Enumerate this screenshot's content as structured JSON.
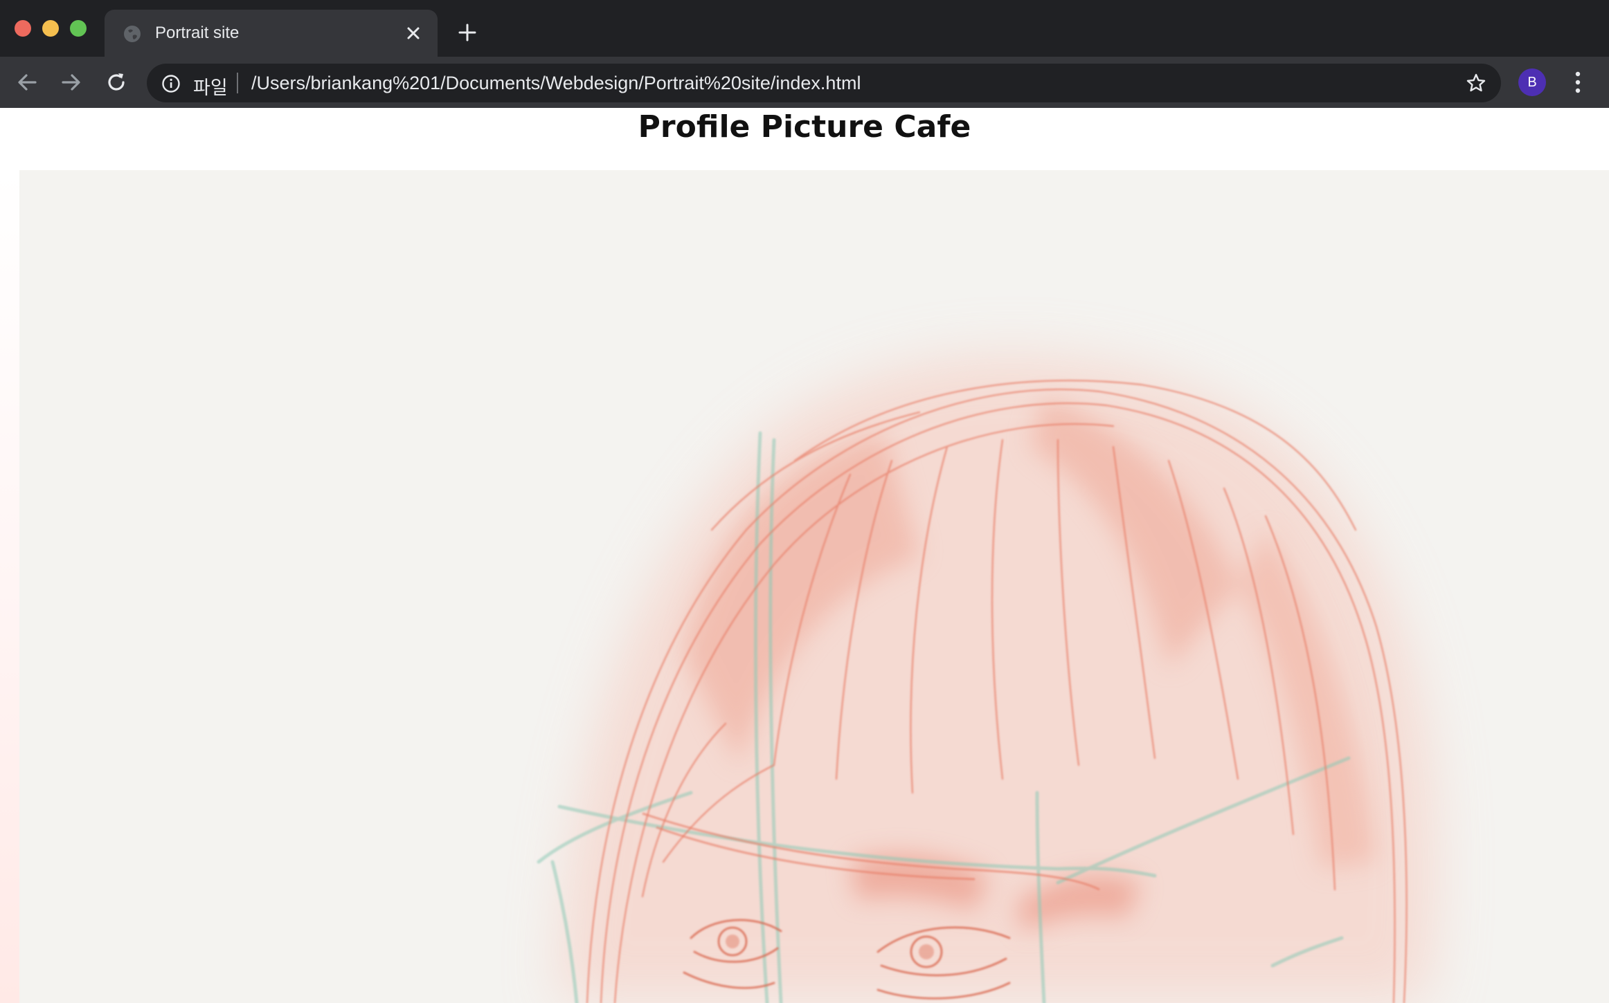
{
  "browser": {
    "tab": {
      "title": "Portrait site"
    },
    "address_bar": {
      "scheme_label": "파일",
      "url": "/Users/briankang%201/Documents/Webdesign/Portrait%20site/index.html"
    },
    "profile": {
      "initial": "B"
    },
    "icons": [
      "globe-icon",
      "close-icon",
      "plus-icon",
      "arrow-left-icon",
      "arrow-right-icon",
      "reload-icon",
      "info-icon",
      "star-icon",
      "kebab-menu-icon"
    ]
  },
  "page": {
    "heading": "Profile Picture Cafe",
    "image": {
      "subject": "pencil-sketch-portrait",
      "colors": {
        "line": "#e8806a",
        "guide": "#8cc9b6",
        "paper": "#f4f3f0"
      }
    }
  },
  "colors": {
    "titlebar": "#202124",
    "toolbar": "#35363a",
    "omnibox": "#202124",
    "avatar": "#4d2fb3"
  }
}
